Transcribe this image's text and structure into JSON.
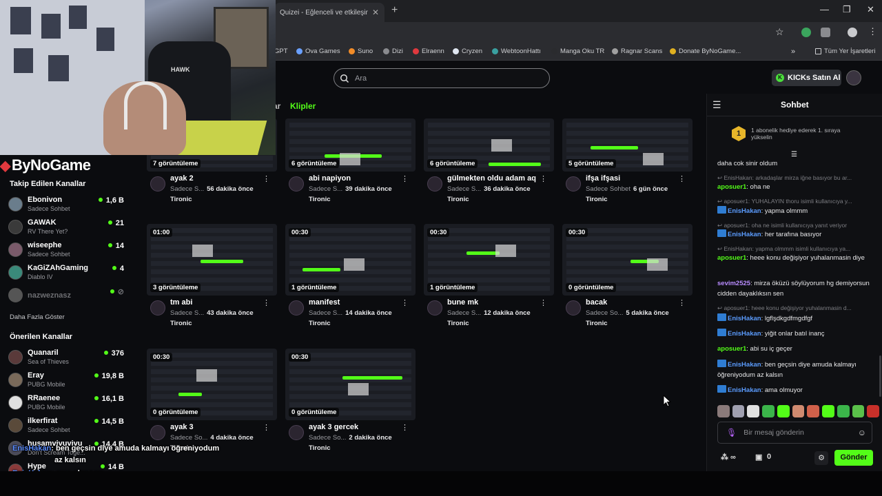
{
  "browser": {
    "tab_title": "Quizei - Eğlenceli ve etkileşimli",
    "bookmarks": [
      "GPT",
      "Ova Games",
      "Suno",
      "Dizi",
      "Elraenn",
      "Cryzen",
      "WebtoonHattı",
      "Manga Oku TR",
      "Ragnar Scans",
      "Donate ByNoGame..."
    ],
    "all_bookmarks": "Tüm Yer İşaretleri"
  },
  "header": {
    "search_placeholder": "Ara",
    "kicks_button": "KICKs Satın Al",
    "tab_partial": "ar",
    "tab_clips": "Klipler"
  },
  "webcam": {
    "chair_logo": "HAWK"
  },
  "sidebar": {
    "logo": "ByNoGame",
    "followed_title": "Takip Edilen Kanallar",
    "followed": [
      {
        "name": "Ebonivon",
        "sub": "Sadece Sohbet",
        "count": "1,6 B",
        "color": "#6a7d8c"
      },
      {
        "name": "GAWAK",
        "sub": "RV There Yet?",
        "count": "21",
        "color": "#3a3a3a"
      },
      {
        "name": "wiseephe",
        "sub": "Sadece Sohbet",
        "count": "14",
        "color": "#7a5a6a"
      },
      {
        "name": "KaGiZAhGaming",
        "sub": "Diablo IV",
        "count": "4",
        "color": "#3a8a7a"
      },
      {
        "name": "nazweznasz",
        "sub": "",
        "count": "",
        "color": "#555"
      }
    ],
    "more_label": "Daha Fazla Göster",
    "recommended_title": "Önerilen Kanallar",
    "recommended": [
      {
        "name": "Quanaril",
        "sub": "Sea of Thieves",
        "count": "376",
        "color": "#5a3a3a"
      },
      {
        "name": "Eray",
        "sub": "PUBG Mobile",
        "count": "19,8 B",
        "color": "#7a6a5a"
      },
      {
        "name": "RRaenee",
        "sub": "PUBG Mobile",
        "count": "16,1 B",
        "color": "#e0e0e0"
      },
      {
        "name": "ilkerfirat",
        "sub": "Sadece Sohbet",
        "count": "14,5 B",
        "color": "#5a4a3a"
      },
      {
        "name": "husamvivuvivu",
        "sub": "Don't Scream Toge...",
        "count": "14,4 B",
        "color": "#4a4a5a"
      },
      {
        "name": "Hype",
        "sub": "",
        "count": "14 B",
        "color": "#8a3a3a"
      }
    ]
  },
  "overlay": {
    "line1_user": "EnisHakan",
    "line1_text": "ben geçsin diye amuda kalmayı öğreniyodum",
    "line1_cont": "az kalsın",
    "line2_user": "EnisHakan",
    "line2_text": "ama olmuyor"
  },
  "clips": [
    {
      "dur": "",
      "views": "7 görüntüleme",
      "title": "ayak 2",
      "cat": "Sadece S...",
      "ago": "56 dakika önce",
      "channel": "Tironic"
    },
    {
      "dur": "",
      "views": "6 görüntüleme",
      "title": "abi napiyon",
      "cat": "Sadece S...",
      "ago": "39 dakika önce",
      "channel": "Tironic"
    },
    {
      "dur": "",
      "views": "6 görüntüleme",
      "title": "gülmekten oldu adam aq",
      "cat": "Sadece S...",
      "ago": "36 dakika önce",
      "channel": "Tironic"
    },
    {
      "dur": "",
      "views": "5 görüntüleme",
      "title": "ifşa ifşasi",
      "cat": "Sadece Sohbet",
      "ago": "6 gün önce",
      "channel": "Tironic"
    },
    {
      "dur": "01:00",
      "views": "3 görüntüleme",
      "title": "tm abi",
      "cat": "Sadece S...",
      "ago": "43 dakika önce",
      "channel": "Tironic"
    },
    {
      "dur": "00:30",
      "views": "1 görüntüleme",
      "title": "manifest",
      "cat": "Sadece S...",
      "ago": "14 dakika önce",
      "channel": "Tironic"
    },
    {
      "dur": "00:30",
      "views": "1 görüntüleme",
      "title": "bune mk",
      "cat": "Sadece S...",
      "ago": "12 dakika önce",
      "channel": "Tironic"
    },
    {
      "dur": "00:30",
      "views": "0 görüntüleme",
      "title": "bacak",
      "cat": "Sadece So...",
      "ago": "5 dakika önce",
      "channel": "Tironic"
    },
    {
      "dur": "00:30",
      "views": "0 görüntüleme",
      "title": "ayak 3",
      "cat": "Sadece So...",
      "ago": "4 dakika önce",
      "channel": "Tironic"
    },
    {
      "dur": "00:30",
      "views": "0 görüntüleme",
      "title": "ayak 3 gercek",
      "cat": "Sadece So...",
      "ago": "2 dakika önce",
      "channel": "Tironic"
    }
  ],
  "chat": {
    "title": "Sohbet",
    "sub_badge": "1",
    "sub_text": "1 abonelik hediye ederek 1. sıraya yükselin",
    "messages": [
      {
        "kind": "plain",
        "user": "",
        "text": "daha cok sinir oldum",
        "color": ""
      },
      {
        "kind": "reply",
        "user": "",
        "text": "EnisHakan: arkadaşlar mirza iğne basıyor bu ar...",
        "color": ""
      },
      {
        "kind": "msg",
        "user": "aposuer1",
        "text": "oha ne",
        "color": "#53fc18"
      },
      {
        "kind": "reply",
        "user": "",
        "text": "aposuer1: YUHALAYIN thoru isimli kullanıcıya y...",
        "color": ""
      },
      {
        "kind": "kmsg",
        "user": "EnisHakan",
        "text": "yapma olmmm",
        "color": "#5b9cff"
      },
      {
        "kind": "reply",
        "user": "",
        "text": "aposuer1: oha ne isimli kullanıcıya yanıt veriyor",
        "color": ""
      },
      {
        "kind": "kmsg",
        "user": "EnisHakan",
        "text": "her tarafına basıyor",
        "color": "#5b9cff"
      },
      {
        "kind": "reply",
        "user": "",
        "text": "EnisHakan: yapma olmmm isimli kullanıcıya ya...",
        "color": ""
      },
      {
        "kind": "msg",
        "user": "aposuer1",
        "text": "heee konu değişiyor yuhalanmasin diye",
        "color": "#53fc18"
      },
      {
        "kind": "msg",
        "user": "sevim2525",
        "text": "mirza ökü​zü söylüyorum hg demiyorsun cidden dayaklıksın sen",
        "color": "#b98cff"
      },
      {
        "kind": "reply",
        "user": "",
        "text": "aposuer1: heee konu değişiyor yuhalanmasin d...",
        "color": ""
      },
      {
        "kind": "kmsg",
        "user": "EnisHakan",
        "text": "lgflşdkgdfmgdfgf",
        "color": "#5b9cff"
      },
      {
        "kind": "kmsg",
        "user": "EnisHakan",
        "text": "yiğit onlar batıl inanç",
        "color": "#5b9cff"
      },
      {
        "kind": "msg",
        "user": "aposuer1",
        "text": "abi su iç geçer",
        "color": "#53fc18"
      },
      {
        "kind": "kmsg",
        "user": "EnisHakan",
        "text": "ben geçsin diye amuda kalmayı öğreniyodum az kalsın",
        "color": "#5b9cff"
      },
      {
        "kind": "kmsg",
        "user": "EnisHakan",
        "text": "ama olmuyor",
        "color": "#5b9cff"
      }
    ],
    "input_placeholder": "Bir mesaj gönderin",
    "kicks_count": "0",
    "send_label": "Gönder"
  },
  "colors": {
    "accent": "#53fc18",
    "background": "#0b0c0f",
    "chat_user_kick": "#5b9cff"
  }
}
